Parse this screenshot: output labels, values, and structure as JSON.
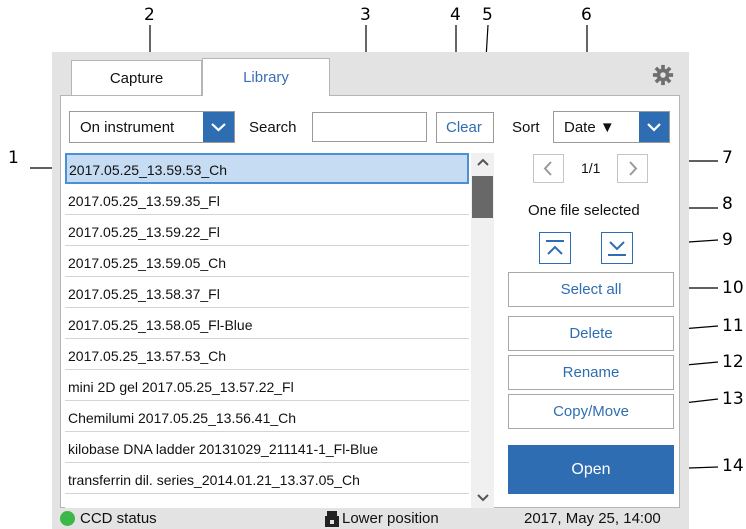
{
  "callouts": [
    "1",
    "2",
    "3",
    "4",
    "5",
    "6",
    "7",
    "8",
    "9",
    "10",
    "11",
    "12",
    "13",
    "14"
  ],
  "tabs": {
    "capture": "Capture",
    "library": "Library"
  },
  "toolbar": {
    "source": "On instrument",
    "search_label": "Search",
    "search_value": "",
    "clear": "Clear",
    "sort_label": "Sort",
    "sort_value": "Date ▼"
  },
  "files": [
    "2017.05.25_13.59.53_Ch",
    "2017.05.25_13.59.35_Fl",
    "2017.05.25_13.59.22_Fl",
    "2017.05.25_13.59.05_Ch",
    "2017.05.25_13.58.37_Fl",
    "2017.05.25_13.58.05_Fl-Blue",
    "2017.05.25_13.57.53_Ch",
    "mini 2D gel 2017.05.25_13.57.22_Fl",
    "Chemilumi 2017.05.25_13.56.41_Ch",
    "kilobase DNA ladder 20131029_211141-1_Fl-Blue",
    "transferrin dil. series_2014.01.21_13.37.05_Ch"
  ],
  "selected_index": 0,
  "pagination": {
    "text": "1/1"
  },
  "selection_status": "One file selected",
  "actions": {
    "select_all": "Select all",
    "delete": "Delete",
    "rename": "Rename",
    "copy_move": "Copy/Move",
    "open": "Open"
  },
  "statusbar": {
    "ccd": "CCD status",
    "position": "Lower position",
    "datetime": "2017, May 25, 14:00"
  },
  "colors": {
    "accent": "#2f6db3",
    "selection": "#c6dcf2",
    "ccd_ok": "#3cb84a"
  },
  "icons": [
    "gear-icon",
    "chevron-down-icon",
    "chevron-up-icon",
    "chevron-left-icon",
    "chevron-right-icon",
    "jump-top-icon",
    "jump-bottom-icon",
    "lens-position-icon"
  ]
}
